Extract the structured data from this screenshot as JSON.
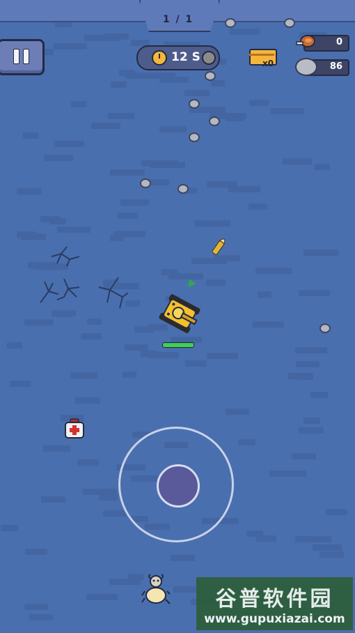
{
  "hud": {
    "wave_progress": "1 / 1",
    "timer": "12 S",
    "chest_count": "x0",
    "meat_count": "0",
    "stone_count": "86",
    "player_health_fraction": 1.0
  },
  "icons": {
    "pause": "pause-icon",
    "timer": "alarm-clock-icon",
    "chest": "treasure-chest-icon",
    "meat": "meat-icon",
    "stone": "stone-icon",
    "medkit": "medkit-icon"
  },
  "watermark": {
    "title": "谷普软件园",
    "url": "www.gupuxiazai.com"
  },
  "colors": {
    "ground": "#4a6fae",
    "hp_fill": "#3fcf54",
    "tank_body": "#f5c02a",
    "joystick_knob": "#5a5a9a"
  }
}
